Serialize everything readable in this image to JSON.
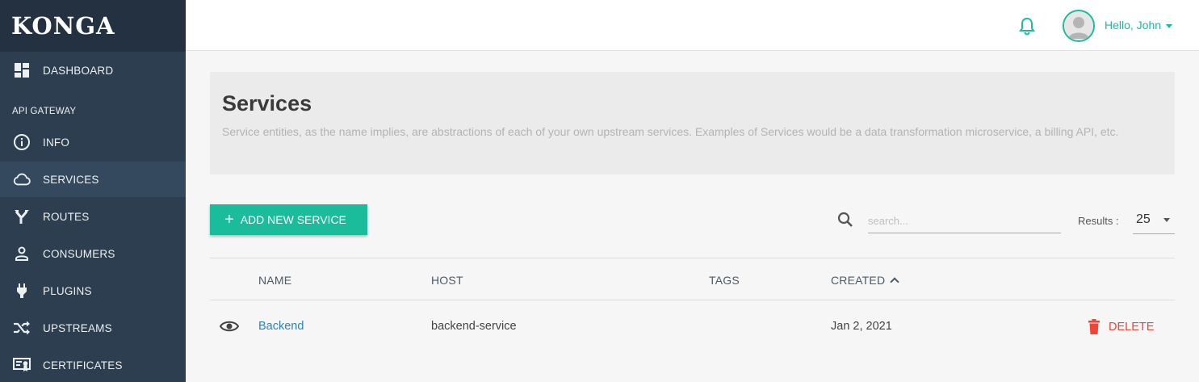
{
  "sidebar": {
    "brand": "KONGA",
    "section_label": "API GATEWAY",
    "items": [
      {
        "label": "DASHBOARD",
        "icon": "dashboard-icon"
      },
      {
        "label": "INFO",
        "icon": "info-icon"
      },
      {
        "label": "SERVICES",
        "icon": "cloud-icon",
        "active": true
      },
      {
        "label": "ROUTES",
        "icon": "routes-icon"
      },
      {
        "label": "CONSUMERS",
        "icon": "person-icon"
      },
      {
        "label": "PLUGINS",
        "icon": "plug-icon"
      },
      {
        "label": "UPSTREAMS",
        "icon": "shuffle-icon"
      },
      {
        "label": "CERTIFICATES",
        "icon": "certificate-icon"
      }
    ]
  },
  "topbar": {
    "user_greeting": "Hello, John",
    "accent_color": "#1abc9c"
  },
  "header": {
    "title": "Services",
    "description": "Service entities, as the name implies, are abstractions of each of your own upstream services. Examples of Services would be a data transformation microservice, a billing API, etc."
  },
  "toolbar": {
    "add_label": "ADD NEW SERVICE",
    "search_placeholder": "search...",
    "results_label": "Results :",
    "results_value": "25"
  },
  "table": {
    "columns": [
      "NAME",
      "HOST",
      "TAGS",
      "CREATED"
    ],
    "rows": [
      {
        "name": "Backend",
        "host": "backend-service",
        "tags": "",
        "created": "Jan 2, 2021",
        "action": "DELETE"
      }
    ]
  },
  "colors": {
    "sidebar": "#2c3e50",
    "accent": "#1abc9c",
    "link": "#2a82c5",
    "danger": "#f44336"
  }
}
